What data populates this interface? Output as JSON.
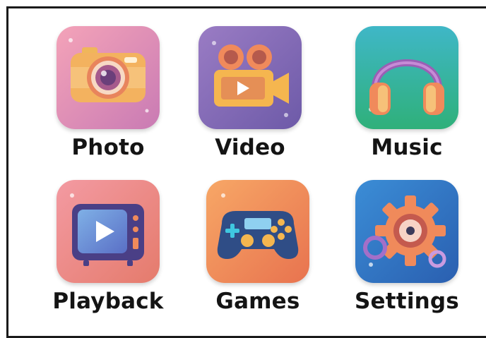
{
  "apps": [
    {
      "id": "photo",
      "label": "Photo",
      "icon": "camera-icon",
      "bg": "#e58fae"
    },
    {
      "id": "video",
      "label": "Video",
      "icon": "video-camera-icon",
      "bg": "#8c6fb4"
    },
    {
      "id": "music",
      "label": "Music",
      "icon": "headphones-icon",
      "bg": "#36b89a"
    },
    {
      "id": "playback",
      "label": "Playback",
      "icon": "tv-play-icon",
      "bg": "#ea8a86"
    },
    {
      "id": "games",
      "label": "Games",
      "icon": "gamepad-icon",
      "bg": "#f0955c"
    },
    {
      "id": "settings",
      "label": "Settings",
      "icon": "gear-icon",
      "bg": "#2f78c4"
    }
  ]
}
